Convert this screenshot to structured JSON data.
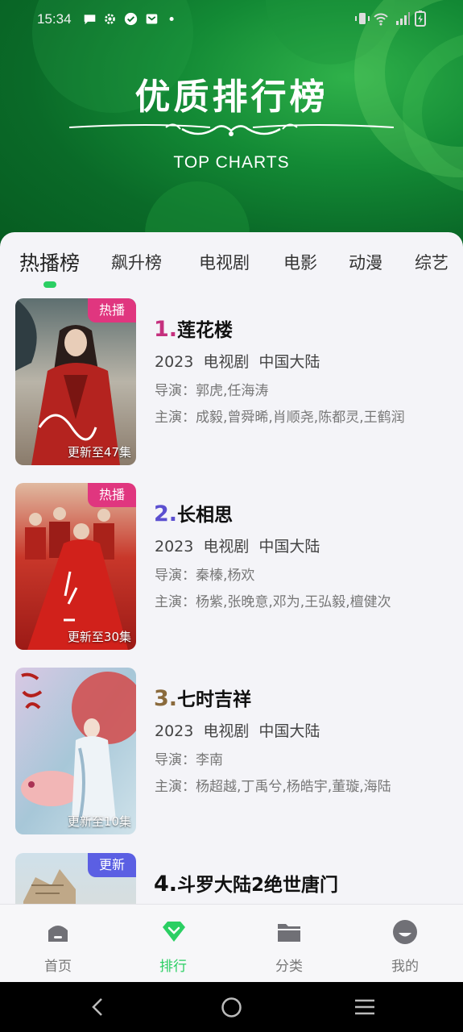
{
  "status_bar": {
    "time": "15:34"
  },
  "banner": {
    "title": "优质排行榜",
    "subtitle": "TOP CHARTS"
  },
  "tabs": [
    "热播榜",
    "飙升榜",
    "电视剧",
    "电影",
    "动漫",
    "综艺"
  ],
  "active_tab": "热播榜",
  "items": [
    {
      "rank": "1.",
      "rank_color": "#c5307e",
      "title": "莲花楼",
      "meta": "2023  电视剧  中国大陆",
      "director": "导演：郭虎,任海涛",
      "cast": "主演：成毅,曾舜晞,肖顺尧,陈都灵,王鹤润",
      "badge": "热播",
      "badge_type": "hot",
      "update": "更新至47集"
    },
    {
      "rank": "2.",
      "rank_color": "#5b4fd0",
      "title": "长相思",
      "meta": "2023  电视剧  中国大陆",
      "director": "导演：秦榛,杨欢",
      "cast": "主演：杨紫,张晚意,邓为,王弘毅,檀健次",
      "badge": "热播",
      "badge_type": "hot",
      "update": "更新至30集"
    },
    {
      "rank": "3.",
      "rank_color": "#8a6a3c",
      "title": "七时吉祥",
      "meta": "2023  电视剧  中国大陆",
      "director": "导演：李南",
      "cast": "主演：杨超越,丁禹兮,杨皓宇,董璇,海陆",
      "badge": "",
      "badge_type": "",
      "update": "更新至10集"
    },
    {
      "rank": "4.",
      "rank_color": "#111111",
      "title": "斗罗大陆2绝世唐门",
      "meta": "",
      "director": "",
      "cast": "",
      "badge": "更新",
      "badge_type": "new",
      "update": ""
    }
  ],
  "bottom_nav": [
    {
      "label": "首页",
      "icon": "home-icon"
    },
    {
      "label": "排行",
      "icon": "ranking-diamond-icon"
    },
    {
      "label": "分类",
      "icon": "folder-icon"
    },
    {
      "label": "我的",
      "icon": "profile-icon"
    }
  ],
  "active_nav": "排行",
  "colors": {
    "accent": "#2bcf63",
    "hot_badge": "#e0367f",
    "new_badge": "#5b5fe3",
    "banner_green": "#138a35"
  }
}
